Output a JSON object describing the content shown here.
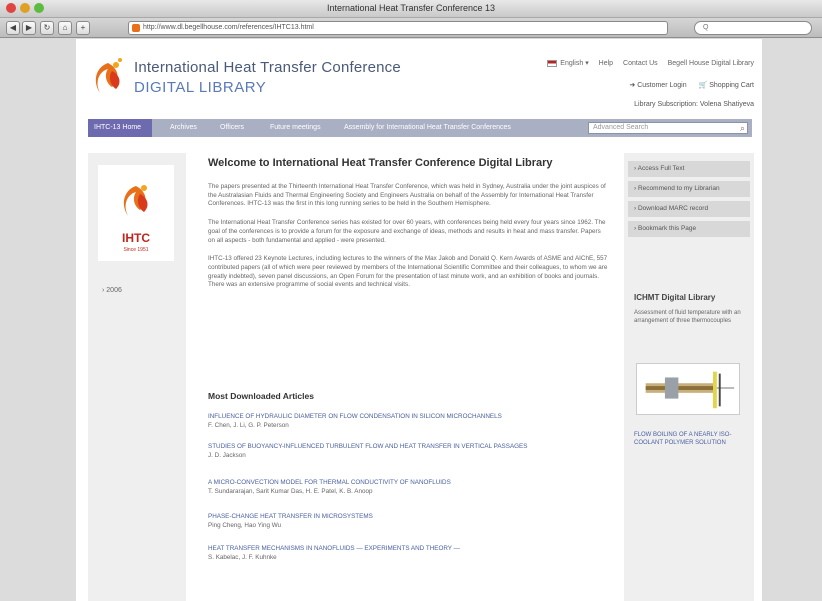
{
  "window": {
    "title": "International Heat Transfer Conference 13"
  },
  "browser": {
    "url": "http://www.dl.begellhouse.com/references/IHTC13.html",
    "back": "◀",
    "forward": "▶",
    "reload": "↻",
    "home": "⌂",
    "add": "+",
    "search_placeholder": "Q"
  },
  "header": {
    "title": "International Heat Transfer Conference",
    "subtitle": "DIGITAL LIBRARY",
    "language": "English",
    "help": "Help",
    "contact": "Contact Us",
    "begell_link": "Begell House Digital Library",
    "customer_login": "Customer Login",
    "shopping_cart": "Shopping Cart",
    "subscription": "Library Subscription: Volena Shatiyeva"
  },
  "nav": {
    "items": [
      "IHTC-13 Home",
      "Archives",
      "Officers",
      "Future meetings",
      "Assembly for International Heat Transfer Conferences"
    ],
    "search_placeholder": "Advanced Search"
  },
  "left": {
    "logo_text": "IHTC",
    "logo_sub": "Since 1951",
    "years": [
      "2006"
    ]
  },
  "main": {
    "welcome": "Welcome to International Heat Transfer Conference Digital Library",
    "paragraphs": [
      "The papers presented at the Thirteenth International Heat Transfer Conference, which was held in Sydney, Australia under the joint auspices of the Australasian Fluids and Thermal Engineering Society and Engineers Australia on behalf of the Assembly for International Heat Transfer Conferences. IHTC-13 was the first in this long running series to be held in the Southern Hemisphere.",
      "The International Heat Transfer Conference series has existed for over 60 years, with conferences being held every four years since 1962. The goal of the conferences is to provide a forum for the exposure and exchange of ideas, methods and results in heat and mass transfer. Papers on all aspects - both fundamental and applied - were presented.",
      "IHTC-13 offered 23 Keynote Lectures, including lectures to the winners of the Max Jakob and Donald Q. Kern Awards of ASME and AIChE, 557 contributed papers (all of which were peer reviewed by members of the International Scientific Committee and their colleagues, to whom we are greatly indebted), seven panel discussions, an Open Forum for the presentation of last minute work, and an exhibition of books and journals. There was an extensive programme of social events and technical visits."
    ],
    "most_downloaded_title": "Most Downloaded Articles",
    "articles": [
      {
        "title": "INFLUENCE OF HYDRAULIC DIAMETER ON FLOW CONDENSATION IN SILICON MICROCHANNELS",
        "authors": "F. Chen, J. Li, G. P. Peterson"
      },
      {
        "title": "STUDIES OF BUOYANCY-INFLUENCED TURBULENT FLOW AND HEAT TRANSFER IN VERTICAL PASSAGES",
        "authors": "J. D. Jackson"
      },
      {
        "title": "A MICRO-CONVECTION MODEL FOR THERMAL CONDUCTIVITY OF NANOFLUIDS",
        "authors": "T. Sundararajan, Sarit Kumar Das, H. E. Patel, K. B. Anoop"
      },
      {
        "title": "PHASE-CHANGE HEAT TRANSFER IN MICROSYSTEMS",
        "authors": "Ping Cheng, Hao Ying Wu"
      },
      {
        "title": "HEAT TRANSFER MECHANISMS IN NANOFLUIDS — EXPERIMENTS AND THEORY —",
        "authors": "S. Kabelac, J. F. Kuhnke"
      }
    ]
  },
  "right": {
    "links": [
      "Access Full Text",
      "Recommend to my Librarian",
      "Download MARC record",
      "Bookmark this Page"
    ],
    "library_title": "ICHMT Digital Library",
    "library_desc": "Assessment of fluid temperature with an arrangement of three thermocouples",
    "library_caption": "FLOW BOILING OF A NEARLY ISO-COOLANT POLYMER SOLUTION"
  },
  "colors": {
    "nav_bg": "#aab0c4",
    "nav_active": "#6e6ab0",
    "title_blue": "#5a7ab8",
    "link_blue": "#4a60a0",
    "ihtc_red": "#c0261f"
  }
}
